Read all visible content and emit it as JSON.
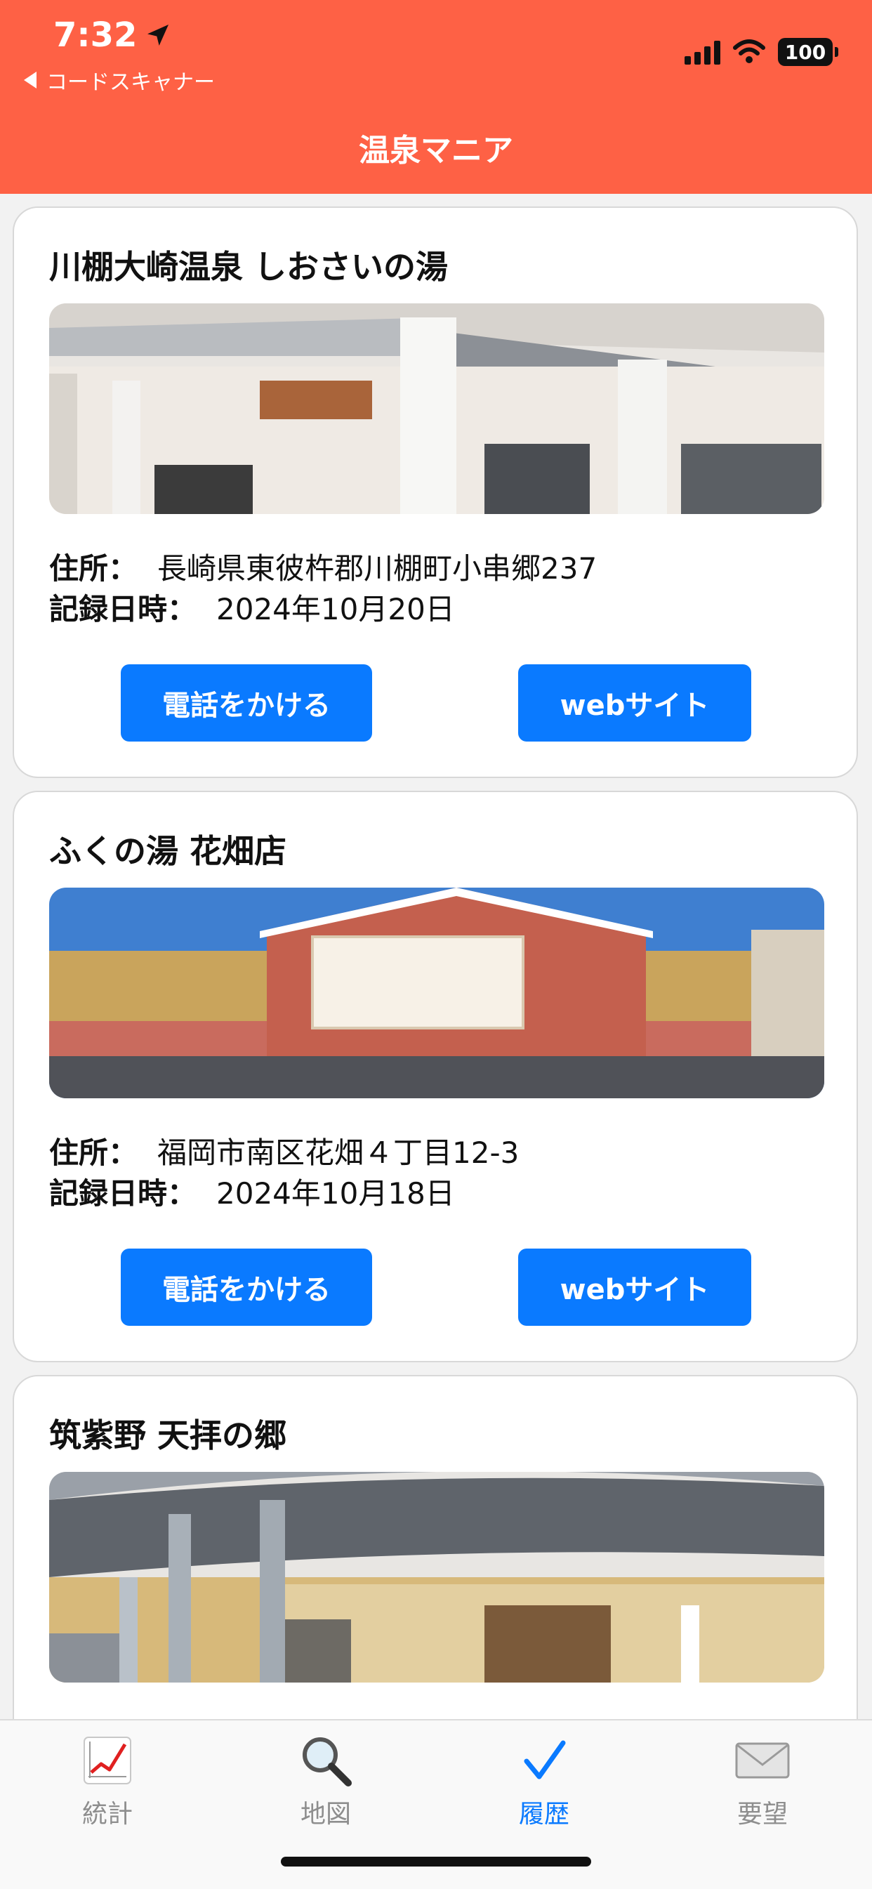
{
  "status_bar": {
    "time": "7:32",
    "back_label": "コードスキャナー",
    "battery": "100"
  },
  "nav": {
    "title": "温泉マニア"
  },
  "labels": {
    "address": "住所：",
    "recorded": "記録日時："
  },
  "cards": [
    {
      "name": "川棚大崎温泉 しおさいの湯",
      "address": "長崎県東彼杵郡川棚町小串郷237",
      "recorded_at": "2024年10月20日",
      "call_label": "電話をかける",
      "web_label": "webサイト"
    },
    {
      "name": "ふくの湯 花畑店",
      "address": "福岡市南区花畑４丁目12-3",
      "recorded_at": "2024年10月18日",
      "call_label": "電話をかける",
      "web_label": "webサイト"
    },
    {
      "name": "筑紫野 天拝の郷"
    }
  ],
  "tabs": [
    {
      "label": "統計",
      "icon": "chart-icon",
      "active": false
    },
    {
      "label": "地図",
      "icon": "magnifier-icon",
      "active": false
    },
    {
      "label": "履歴",
      "icon": "checkmark-icon",
      "active": true
    },
    {
      "label": "要望",
      "icon": "envelope-icon",
      "active": false
    }
  ],
  "colors": {
    "header": "#fe6145",
    "button": "#0a7aff",
    "active_tab": "#0a7aff",
    "inactive_tab": "#8e8e8e"
  }
}
